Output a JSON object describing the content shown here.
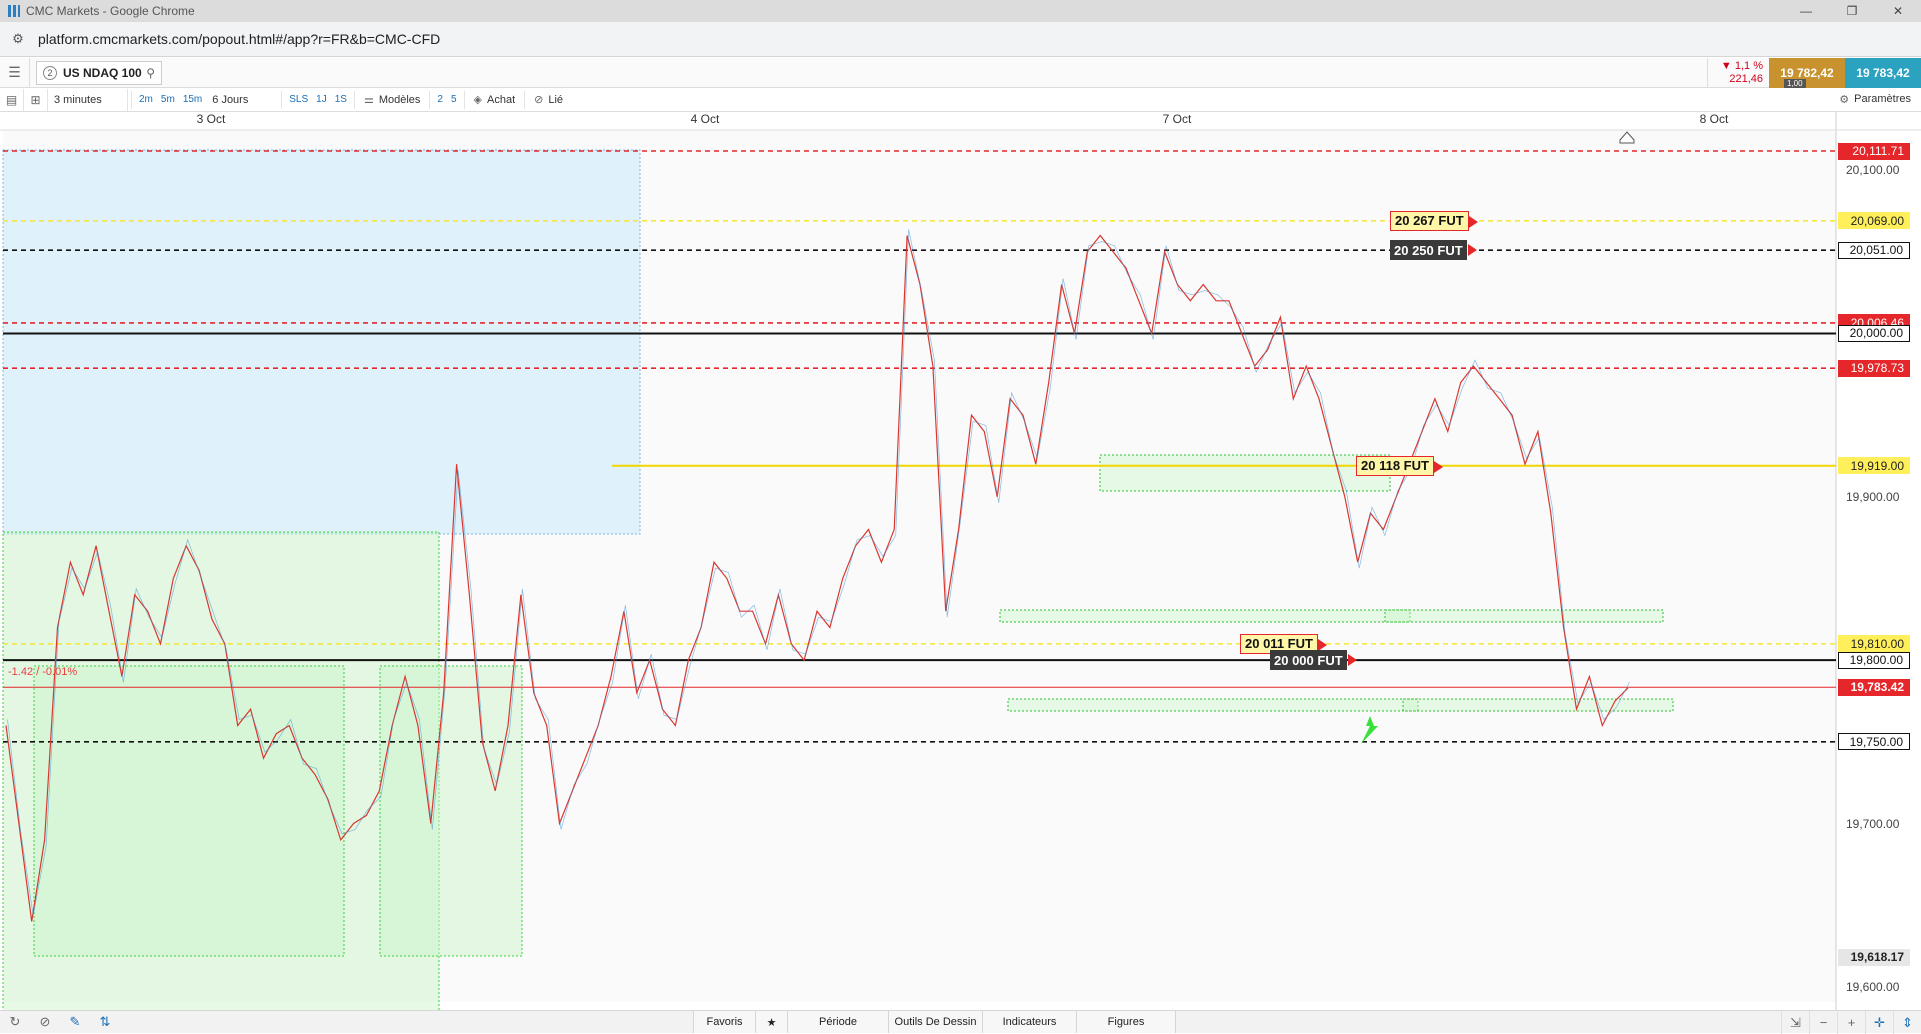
{
  "window": {
    "title": "CMC Markets - Google Chrome",
    "url": "platform.cmcmarkets.com/popout.html#/app?r=FR&b=CMC-CFD"
  },
  "instrument": {
    "number": "2",
    "name": "US NDAQ 100"
  },
  "quote": {
    "change_pct": "▼ 1,1 %",
    "change_pts": "221,46",
    "sell": "19 782,42",
    "buy": "19 783,42",
    "spread": "1,00"
  },
  "toolbar": {
    "period": "3 minutes",
    "quick_periods": [
      "2m",
      "5m",
      "15m"
    ],
    "range": "6 Jours",
    "extra_periods": [
      "SLS",
      "1J",
      "1S"
    ],
    "models_label": "Modèles",
    "counts": [
      "2",
      "5"
    ],
    "buy_label": "Achat",
    "link_label": "Lié",
    "settings_label": "Paramètres"
  },
  "chart_data": {
    "type": "line",
    "title": "",
    "instrument": "US NDAQ 100",
    "interval": "3 minutes",
    "x_labels": [
      "3 Oct",
      "4 Oct",
      "7 Oct",
      "8 Oct"
    ],
    "y_ticks": [
      "20,100.00",
      "19,900.00",
      "19,700.00",
      "19,600.00"
    ],
    "ylim": [
      19585,
      20130
    ],
    "last_price": "19,783.42",
    "change_label": "-1.42 / -0.01%",
    "horizontal_levels": [
      {
        "value": 20111.71,
        "label": "20,111.71",
        "style": "dashed",
        "color": "#e5262a"
      },
      {
        "value": 20069.0,
        "label": "20,069.00",
        "style": "dashed",
        "color": "#f5e642"
      },
      {
        "value": 20051.0,
        "label": "20,051.00",
        "style": "dashed",
        "color": "#111111"
      },
      {
        "value": 20006.46,
        "label": "20,006.46",
        "style": "dashed",
        "color": "#e5262a"
      },
      {
        "value": 20000.0,
        "label": "20,000.00",
        "style": "solid",
        "color": "#111111"
      },
      {
        "value": 19978.73,
        "label": "19,978.73",
        "style": "dashed",
        "color": "#e5262a"
      },
      {
        "value": 19919.0,
        "label": "19,919.00",
        "style": "solid",
        "color": "#f5e642"
      },
      {
        "value": 19810.0,
        "label": "19,810.00",
        "style": "dashed",
        "color": "#f5e642"
      },
      {
        "value": 19800.0,
        "label": "19,800.00",
        "style": "solid",
        "color": "#111111"
      },
      {
        "value": 19783.42,
        "label": "19,783.42",
        "style": "solid",
        "color": "#e5262a"
      },
      {
        "value": 19750.0,
        "label": "19,750.00",
        "style": "dashed",
        "color": "#111111"
      },
      {
        "value": 19618.17,
        "label": "19,618.17",
        "style": "none",
        "color": "#dddddd"
      }
    ],
    "annotations": [
      {
        "text": "20 267 FUT",
        "value": 20069.0
      },
      {
        "text": "20 250 FUT",
        "value": 20051.0
      },
      {
        "text": "20 118 FUT",
        "value": 19919.0
      },
      {
        "text": "20 011 FUT",
        "value": 19810.0
      },
      {
        "text": "20 000 FUT",
        "value": 19800.0
      }
    ],
    "series": [
      {
        "values": [
          19760,
          19700,
          19640,
          19690,
          19820,
          19860,
          19840,
          19870,
          19830,
          19790,
          19840,
          19830,
          19810,
          19850,
          19870,
          19855,
          19825,
          19810,
          19760,
          19770,
          19740,
          19755,
          19760,
          19740,
          19730,
          19715,
          19690,
          19700,
          19705,
          19720,
          19760,
          19790,
          19760,
          19700,
          19780,
          19920,
          19840,
          19750,
          19720,
          19760,
          19840,
          19780,
          19760,
          19700,
          19720,
          19740,
          19760,
          19790,
          19830,
          19780,
          19800,
          19770,
          19760,
          19800,
          19820,
          19860,
          19850,
          19830,
          19830,
          19810,
          19840,
          19810,
          19800,
          19830,
          19820,
          19850,
          19870,
          19880,
          19860,
          19880,
          20060,
          20030,
          19980,
          19830,
          19880,
          19950,
          19940,
          19900,
          19960,
          19950,
          19920,
          19970,
          20030,
          20000,
          20050,
          20060,
          20050,
          20040,
          20020,
          20000,
          20050,
          20030,
          20020,
          20030,
          20020,
          20020,
          20000,
          19980,
          19990,
          20010,
          19960,
          19980,
          19960,
          19930,
          19900,
          19860,
          19890,
          19880,
          19900,
          19920,
          19940,
          19960,
          19940,
          19970,
          19980,
          19970,
          19960,
          19950,
          19920,
          19940,
          19890,
          19820,
          19770,
          19790,
          19760,
          19775,
          19783
        ]
      }
    ]
  },
  "bottom": {
    "tabs": [
      "Favoris",
      "Période",
      "Outils De Dessin",
      "Indicateurs",
      "Figures"
    ]
  }
}
